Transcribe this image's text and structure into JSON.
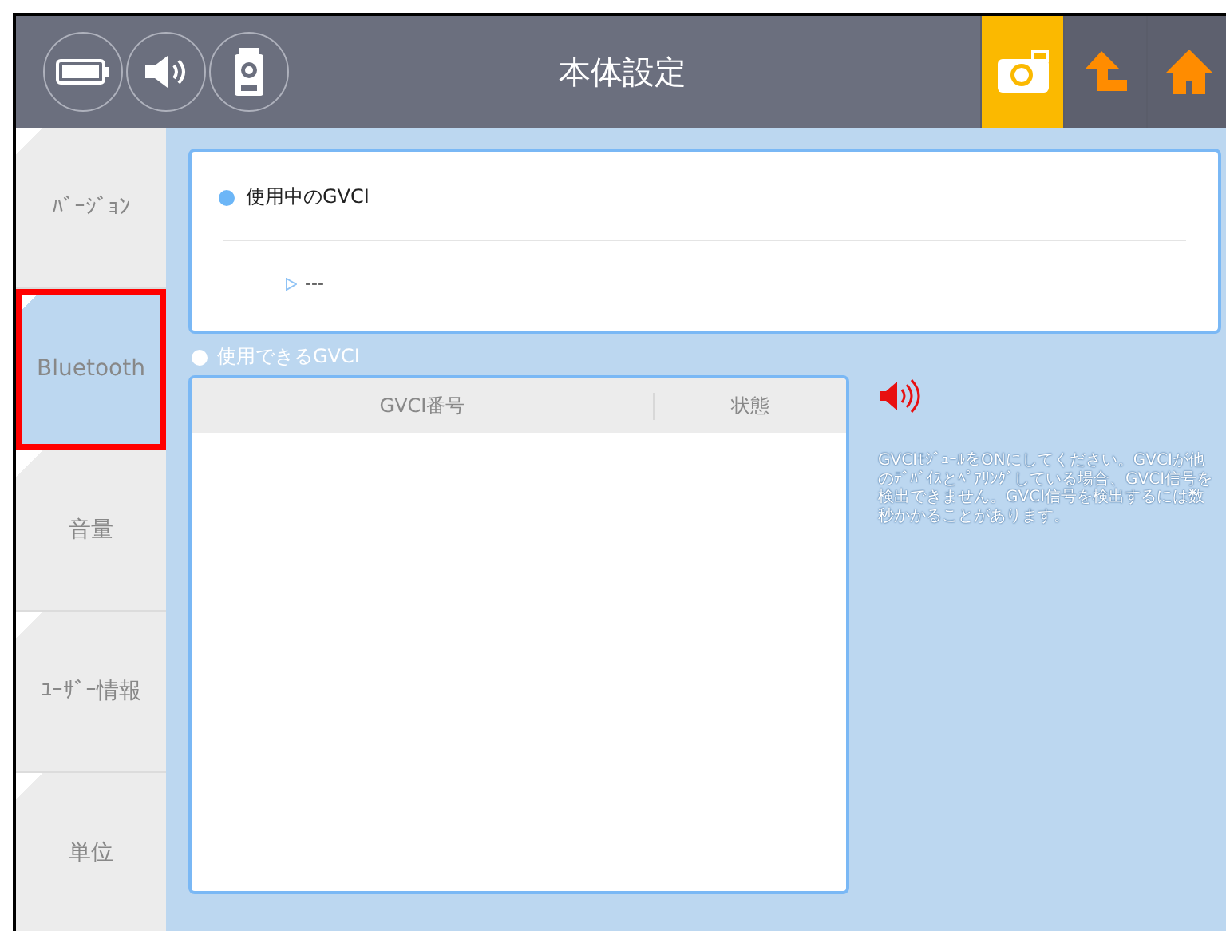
{
  "header": {
    "title": "本体設定",
    "left_icons": [
      {
        "kind": "battery"
      },
      {
        "kind": "speaker"
      },
      {
        "kind": "device"
      }
    ],
    "right_buttons": [
      {
        "kind": "camera",
        "selected": true
      },
      {
        "kind": "up",
        "selected": false
      },
      {
        "kind": "home",
        "selected": false
      }
    ]
  },
  "sidebar": {
    "items": [
      {
        "label": "ﾊﾞｰｼﾞｮﾝ",
        "selected": false
      },
      {
        "label": "Bluetooth",
        "selected": true
      },
      {
        "label": "音量",
        "selected": false
      },
      {
        "label": "ﾕｰｻﾞｰ情報",
        "selected": false
      },
      {
        "label": "単位",
        "selected": false
      }
    ]
  },
  "current": {
    "heading": "使用中のGVCI",
    "value": "---"
  },
  "available": {
    "heading": "使用できるGVCI",
    "columns": [
      "GVCI番号",
      "状態"
    ]
  },
  "notice": "GVCIﾓｼﾞｭｰﾙをONにしてください。GVCIが他のﾃﾞﾊﾞｲｽとﾍﾟｱﾘﾝｸﾞしている場合、GVCI信号を検出できません。GVCI信号を検出するには数秒かかることがあります。"
}
